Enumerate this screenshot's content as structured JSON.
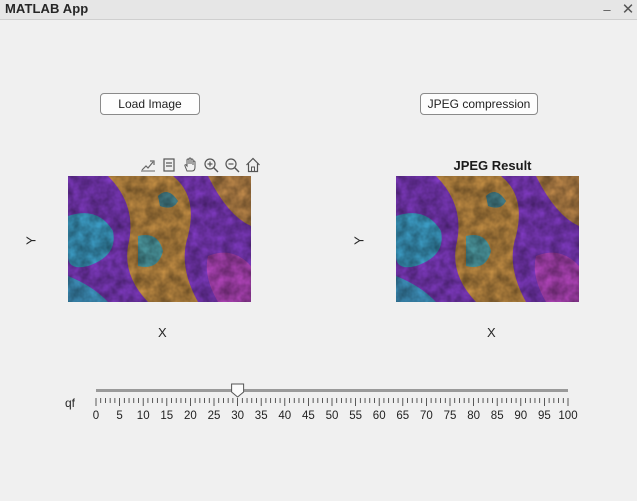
{
  "window": {
    "title": "MATLAB App",
    "minimize_glyph": "–",
    "close_glyph": "✕"
  },
  "buttons": {
    "load_image": "Load Image",
    "jpeg_compression": "JPEG compression"
  },
  "toolbar": {
    "icons": [
      "export-icon",
      "datatip-icon",
      "pan-icon",
      "zoom-in-icon",
      "zoom-out-icon",
      "home-icon"
    ]
  },
  "axes_left": {
    "xlabel": "X",
    "ylabel": "Y",
    "title": ""
  },
  "axes_right": {
    "xlabel": "X",
    "ylabel": "Y",
    "title": "JPEG Result"
  },
  "slider": {
    "label": "qf",
    "min": 0,
    "max": 100,
    "value": 30,
    "major_ticks": [
      0,
      5,
      10,
      15,
      20,
      25,
      30,
      35,
      40,
      45,
      50,
      55,
      60,
      65,
      70,
      75,
      80,
      85,
      90,
      95,
      100
    ],
    "tick_labels": [
      "0",
      "5",
      "10",
      "15",
      "20",
      "25",
      "30",
      "35",
      "40",
      "45",
      "50",
      "55",
      "60",
      "65",
      "70",
      "75",
      "80",
      "85",
      "90",
      "95",
      "100"
    ]
  },
  "colors": {
    "background": "#f0f0f0",
    "titlebar": "#e6e6e6",
    "image_purple": "#8a3fd1",
    "image_cyan": "#39b6d6",
    "image_gold": "#d8a23a",
    "image_magenta": "#c94cc9"
  }
}
